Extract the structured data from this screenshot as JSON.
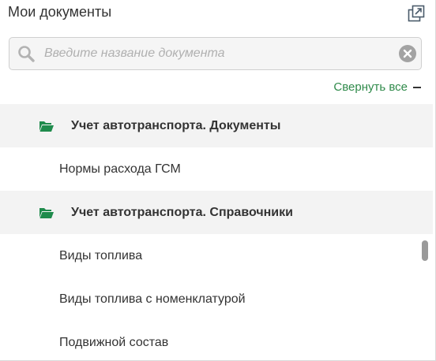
{
  "header": {
    "title": "Мои документы",
    "expand_icon": "popout-icon"
  },
  "search": {
    "placeholder": "Введите название документа",
    "value": "",
    "icon": "search-icon",
    "clear_icon": "clear-icon"
  },
  "collapse_all": {
    "label": "Свернуть все"
  },
  "tree": [
    {
      "type": "group",
      "label": "Учет автотранспорта. Документы",
      "icon": "folder-open-icon"
    },
    {
      "type": "item",
      "label": "Нормы расхода ГСМ"
    },
    {
      "type": "group",
      "label": "Учет автотранспорта. Справочники",
      "icon": "folder-open-icon"
    },
    {
      "type": "item",
      "label": "Виды топлива"
    },
    {
      "type": "item",
      "label": "Виды топлива с номенклатурой"
    },
    {
      "type": "item",
      "label": "Подвижной состав"
    }
  ],
  "colors": {
    "accent": "#1f8b4c",
    "link": "#2f8a4a",
    "group_bg": "#f3f3f3"
  }
}
